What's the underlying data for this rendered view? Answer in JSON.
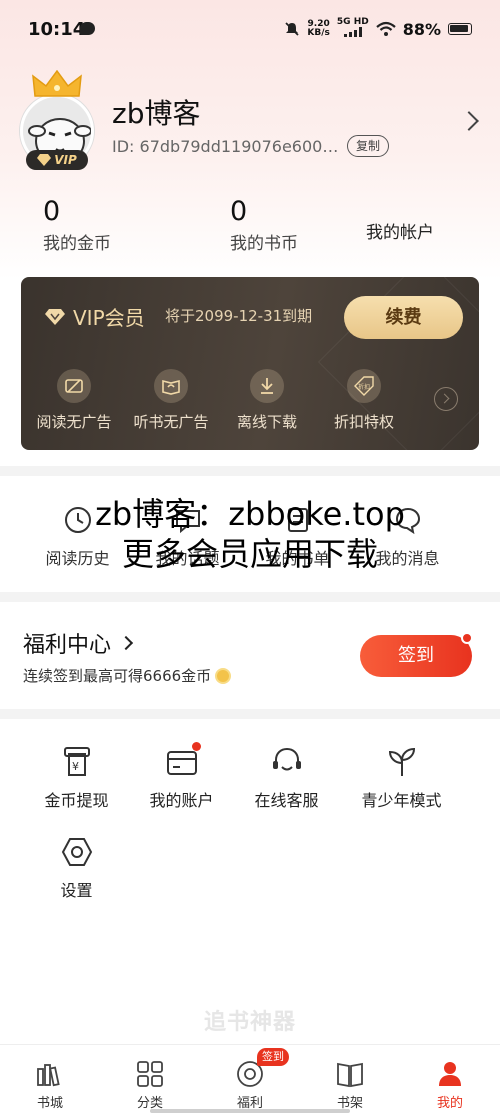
{
  "status_bar": {
    "time": "10:14",
    "net_speed": "9.20",
    "net_unit": "KB/s",
    "net_type": "5G HD",
    "battery": "88%"
  },
  "profile": {
    "name": "zb博客",
    "id": "ID: 67db79dd119076e600…",
    "copy_label": "复制",
    "vip_badge": "VIP"
  },
  "stats": {
    "coins_value": "0",
    "coins_label": "我的金币",
    "book_coins_value": "0",
    "book_coins_label": "我的书币",
    "account_label": "我的帐户"
  },
  "vip_card": {
    "title": "VIP会员",
    "expire": "将于2099-12-31到期",
    "renew_label": "续费",
    "perks": [
      {
        "label": "阅读无广告",
        "icon": "no-ad-icon"
      },
      {
        "label": "听书无广告",
        "icon": "audio-book-icon"
      },
      {
        "label": "离线下载",
        "icon": "download-icon"
      },
      {
        "label": "折扣特权",
        "icon": "discount-tag-icon",
        "icon_text": "折扣"
      }
    ]
  },
  "quick_row": [
    {
      "label": "阅读历史",
      "icon": "history-icon"
    },
    {
      "label": "我的话题",
      "icon": "topic-icon"
    },
    {
      "label": "我的书单",
      "icon": "booklist-icon"
    },
    {
      "label": "我的消息",
      "icon": "message-icon"
    }
  ],
  "overlay_watermark": {
    "line1": "zb博客：zbboke.top",
    "line2": "更多会员应用下载"
  },
  "welfare": {
    "title": "福利中心",
    "subtitle": "连续签到最高可得6666金币",
    "signin_label": "签到"
  },
  "tools": [
    {
      "label": "金币提现",
      "icon": "coin-withdraw-icon"
    },
    {
      "label": "我的账户",
      "icon": "wallet-icon"
    },
    {
      "label": "在线客服",
      "icon": "customer-service-icon"
    },
    {
      "label": "青少年模式",
      "icon": "sprout-icon"
    },
    {
      "label": "设置",
      "icon": "settings-icon"
    }
  ],
  "brand_watermark": "追书神器",
  "tabbar": {
    "tabs": [
      {
        "label": "书城",
        "icon": "bookstore-icon"
      },
      {
        "label": "分类",
        "icon": "category-icon"
      },
      {
        "label": "福利",
        "icon": "welfare-icon"
      },
      {
        "label": "书架",
        "icon": "bookshelf-icon"
      },
      {
        "label": "我的",
        "icon": "profile-icon"
      }
    ],
    "welfare_badge": "签到",
    "active_index": 4
  },
  "colors": {
    "accent": "#e8331f",
    "vip_gold": "#f1d9a8",
    "vip_card_bg": "#3a332d"
  }
}
